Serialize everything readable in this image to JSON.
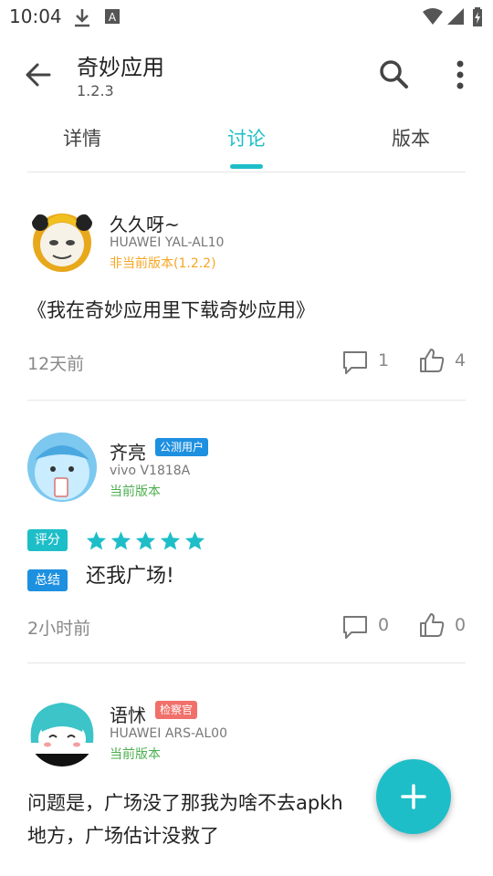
{
  "status_bar": {
    "time": "10:04"
  },
  "app": {
    "title": "奇妙应用",
    "version": "1.2.3"
  },
  "tabs": [
    {
      "label": "详情"
    },
    {
      "label": "讨论"
    },
    {
      "label": "版本"
    }
  ],
  "active_tab": "讨论",
  "colors": {
    "accent": "#1ebec8",
    "orange": "#f5a623",
    "green": "#4caf50",
    "blue_badge": "#1e90e0",
    "red_badge": "#f0706a"
  },
  "posts": [
    {
      "user": "久久呀~",
      "badge": "",
      "device": "HUAWEI YAL-AL10",
      "version_note": "非当前版本(1.2.2)",
      "content": "《我在奇妙应用里下载奇妙应用》",
      "time": "12天前",
      "comments": "1",
      "likes": "4"
    },
    {
      "user": "齐亮",
      "badge": "公测用户",
      "device": "vivo V1818A",
      "version_note": "当前版本",
      "rating_label": "评分",
      "rating": 5,
      "summary_label": "总结",
      "summary": "还我广场!",
      "time": "2小时前",
      "comments": "0",
      "likes": "0"
    },
    {
      "user": "语怵",
      "badge": "检察官",
      "device": "HUAWEI ARS-AL00",
      "version_note": "当前版本",
      "content_line1": "问题是，广场没了那我为啥不去apkh",
      "content_line2": "地方，广场估计没救了"
    }
  ]
}
